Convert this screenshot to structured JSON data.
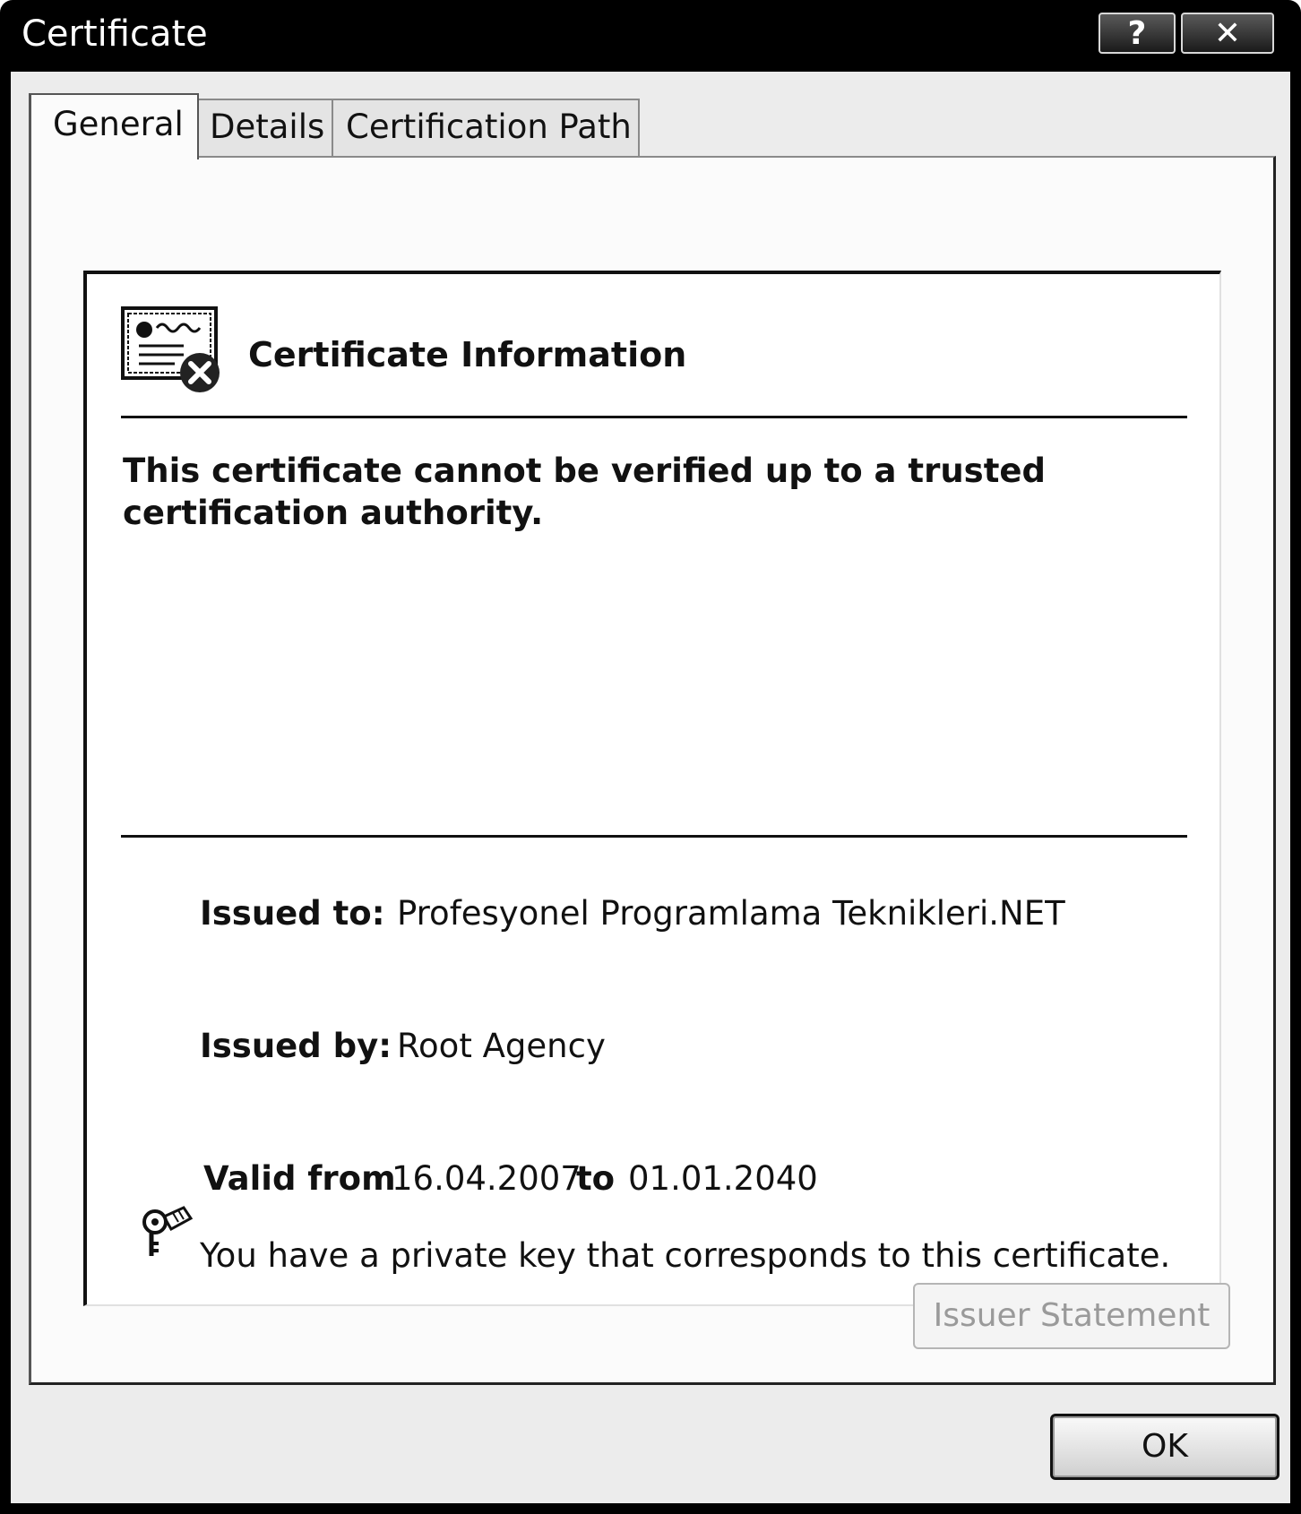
{
  "window": {
    "title": "Certificate",
    "help_label": "?",
    "close_label": "✕"
  },
  "tabs": [
    {
      "label": "General",
      "active": true
    },
    {
      "label": "Details",
      "active": false
    },
    {
      "label": "Certification Path",
      "active": false
    }
  ],
  "info": {
    "icon": "certificate-error-icon",
    "heading": "Certificate Information",
    "warning": "This certificate cannot be verified up to a trusted certification authority."
  },
  "fields": {
    "issued_to_label": "Issued to:",
    "issued_to_value": "Profesyonel Programlama Teknikleri.NET",
    "issued_by_label": "Issued by:",
    "issued_by_value": "Root Agency",
    "valid_from_label": "Valid from",
    "valid_from_value": "16.04.2007",
    "valid_to_label": "to",
    "valid_to_value": "01.01.2040"
  },
  "private_key": {
    "icon": "key-icon",
    "text": "You have a private key that corresponds to this certificate."
  },
  "buttons": {
    "issuer_statement": "Issuer Statement",
    "ok": "OK"
  }
}
